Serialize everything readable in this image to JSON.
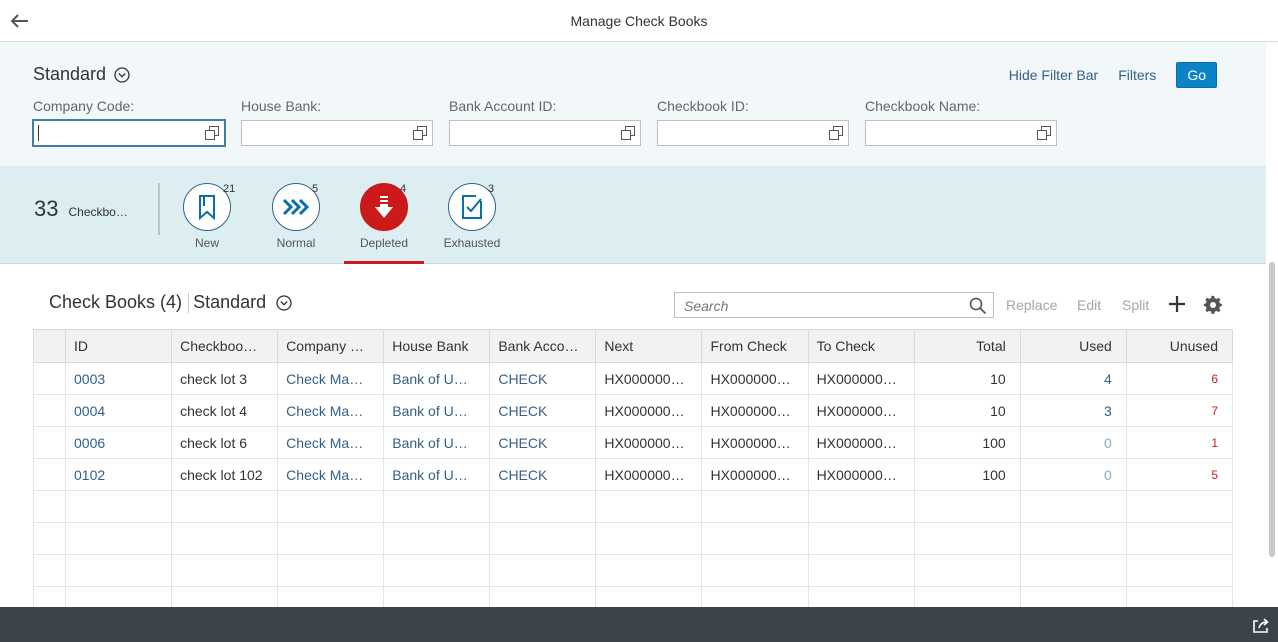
{
  "header": {
    "title": "Manage Check Books"
  },
  "filterbar": {
    "variant": "Standard",
    "hide_filter_bar": "Hide Filter Bar",
    "filters": "Filters",
    "go": "Go",
    "fields": [
      {
        "label": "Company Code:",
        "value": ""
      },
      {
        "label": "House Bank:",
        "value": ""
      },
      {
        "label": "Bank Account ID:",
        "value": ""
      },
      {
        "label": "Checkbook ID:",
        "value": ""
      },
      {
        "label": "Checkbook Name:",
        "value": ""
      }
    ]
  },
  "tabs": {
    "count": "33",
    "count_label": "Checkbo…",
    "items": [
      {
        "label": "New",
        "badge": "21",
        "icon": "bookmark-icon"
      },
      {
        "label": "Normal",
        "badge": "5",
        "icon": "forward-icon"
      },
      {
        "label": "Depleted",
        "badge": "4",
        "icon": "arrow-down-icon",
        "selected": true
      },
      {
        "label": "Exhausted",
        "badge": "3",
        "icon": "document-check-icon"
      }
    ],
    "accent": "#cc1919"
  },
  "table": {
    "title": "Check Books (4)",
    "variant": "Standard",
    "search_placeholder": "Search",
    "actions": {
      "replace": "Replace",
      "edit": "Edit",
      "split": "Split"
    },
    "columns": [
      "ID",
      "Checkboo…",
      "Company …",
      "House Bank",
      "Bank Acco…",
      "Next",
      "From Check",
      "To Check",
      "Total",
      "Used",
      "Unused"
    ],
    "rows": [
      [
        "0003",
        "check lot 3",
        "Check Ma…",
        "Bank of U…",
        "CHECK",
        "HX000000…",
        "HX000000…",
        "HX000000…",
        "10",
        "4",
        "6"
      ],
      [
        "0004",
        "check lot 4",
        "Check Ma…",
        "Bank of U…",
        "CHECK",
        "HX000000…",
        "HX000000…",
        "HX000000…",
        "10",
        "3",
        "7"
      ],
      [
        "0006",
        "check lot 6",
        "Check Ma…",
        "Bank of U…",
        "CHECK",
        "HX000000…",
        "HX000000…",
        "HX000000…",
        "100",
        "0",
        "1"
      ],
      [
        "0102",
        "check lot 102",
        "Check Ma…",
        "Bank of U…",
        "CHECK",
        "HX000000…",
        "HX000000…",
        "HX000000…",
        "100",
        "0",
        "5"
      ]
    ]
  },
  "colors": {
    "link": "#346187",
    "go_button": "#0a84c6",
    "footer": "#3d434a"
  }
}
